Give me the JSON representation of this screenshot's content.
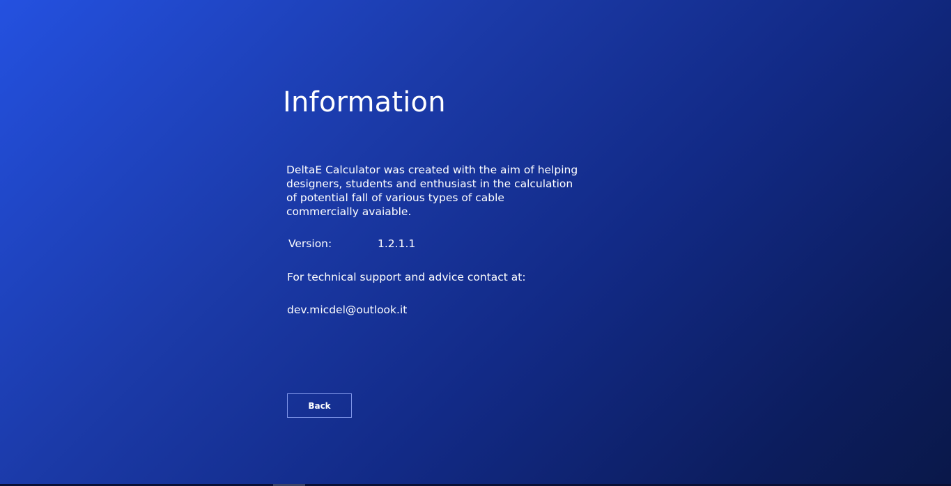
{
  "page": {
    "title": "Information"
  },
  "info": {
    "description": "DeltaE Calculator was created with the aim of helping designers, students and enthusiast in the calculation of potential fall of various types of cable commercially avaiable.",
    "version_label": "Version:",
    "version_value": "1.2.1.1",
    "support_text": "For technical support and advice contact at:",
    "contact_email": "dev.micdel@outlook.it"
  },
  "actions": {
    "back_label": "Back"
  },
  "colors": {
    "background_start": "#2451e0",
    "background_end": "#0a1849",
    "text": "#ffffff",
    "button_border": "#7f95e8"
  }
}
